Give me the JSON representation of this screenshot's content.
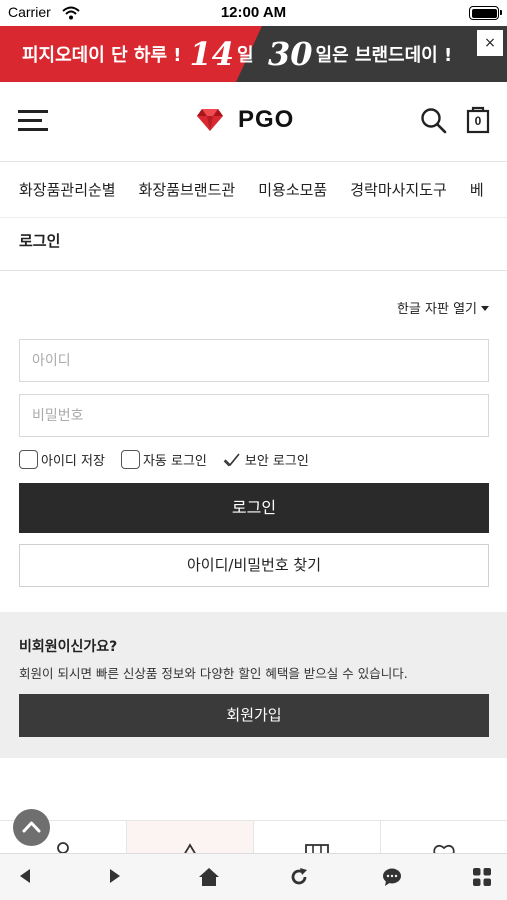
{
  "status_bar": {
    "carrier": "Carrier",
    "time": "12:00 AM"
  },
  "banner": {
    "left_text_a": "피지오데이 단 하루 !",
    "left_number": "14",
    "left_text_b": "일",
    "right_number": "30",
    "right_text": "일은 브랜드데이 !",
    "close_label": "×",
    "colors": {
      "red": "#d9282f",
      "dark": "#3a3a3a"
    }
  },
  "header": {
    "logo_text": "PGO",
    "cart_count": "0",
    "logo_color": "#d9282f"
  },
  "categories": [
    "화장품관리순별",
    "화장품브랜드관",
    "미용소모품",
    "경락마사지도구",
    "베"
  ],
  "page": {
    "title": "로그인"
  },
  "login": {
    "keyboard_toggle": "한글 자판 열기",
    "id_placeholder": "아이디",
    "pw_placeholder": "비밀번호",
    "save_id": "아이디 저장",
    "auto_login": "자동 로그인",
    "secure_login": "보안 로그인",
    "login_button": "로그인",
    "find_button": "아이디/비밀번호 찾기"
  },
  "join": {
    "question": "비회원이신가요?",
    "description": "회원이 되시면 빠른 신상품 정보와 다양한 할인 혜택을 받으실 수 있습니다.",
    "button": "회원가입"
  },
  "toolbar_icons": [
    "back-icon",
    "forward-icon",
    "home-icon",
    "refresh-icon",
    "chat-icon",
    "apps-icon"
  ]
}
